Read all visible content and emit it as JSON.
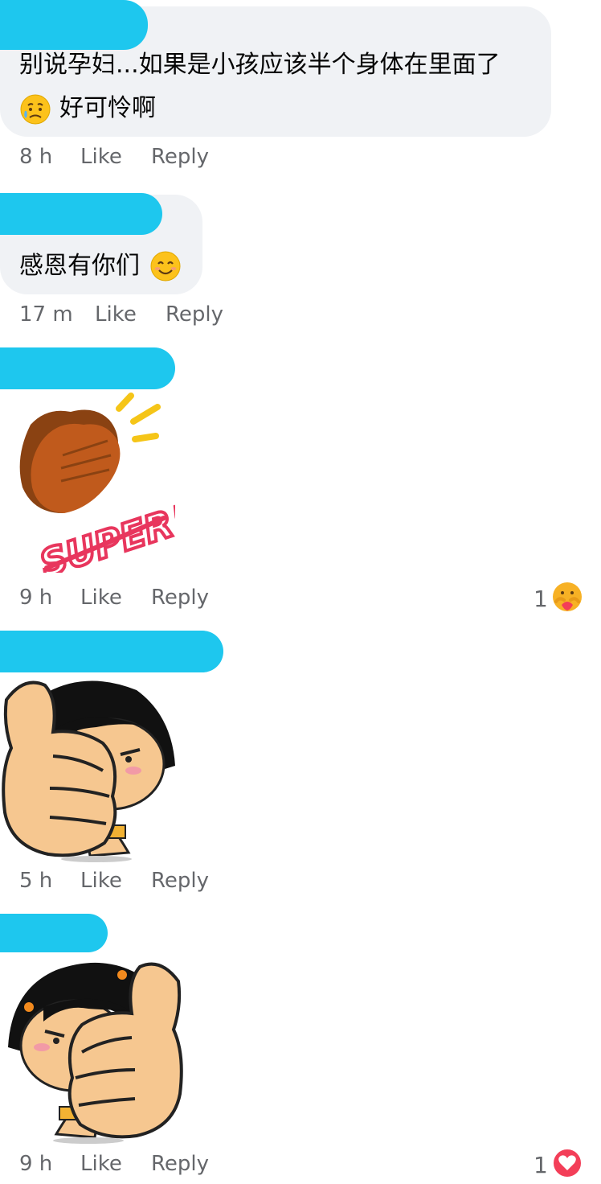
{
  "comments": [
    {
      "text_line1": "别说孕妇...如果是小孩应该半个身体在里面了",
      "text_line2": "好可怜啊",
      "emoji": "sad-sweat-emoji",
      "time": "8 h",
      "like": "Like",
      "reply": "Reply"
    },
    {
      "text_line1": "感恩有你们",
      "emoji": "smiling-face-emoji",
      "time": "17 m",
      "like": "Like",
      "reply": "Reply"
    },
    {
      "sticker": "clapping-hands-super-sticker",
      "sticker_text": "SUPER!",
      "time": "9 h",
      "like": "Like",
      "reply": "Reply",
      "reaction_count": "1",
      "reaction": "care-reaction"
    },
    {
      "sticker": "cartoon-girl-thumbs-up-sticker",
      "time": "5 h",
      "like": "Like",
      "reply": "Reply"
    },
    {
      "sticker": "cartoon-girl-thumbs-up-sticker",
      "time": "9 h",
      "like": "Like",
      "reply": "Reply",
      "reaction_count": "1",
      "reaction": "love-reaction"
    }
  ],
  "colors": {
    "bubble": "#f0f2f5",
    "redaction": "#1ec7ee",
    "meta_text": "#65676b",
    "love_red": "#f33e58"
  }
}
